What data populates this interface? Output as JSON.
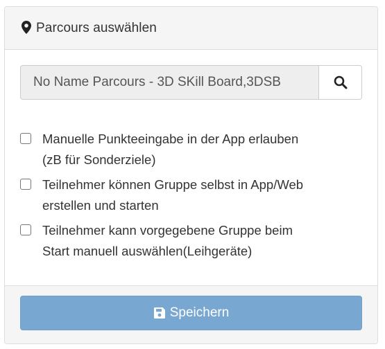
{
  "panel": {
    "title": "Parcours auswählen",
    "title_icon": "map-marker-icon"
  },
  "search": {
    "value": "No Name Parcours - 3D SKill Board,3DSB",
    "button_icon": "search-icon"
  },
  "options": [
    {
      "label_line1": "Manuelle Punkteeingabe in der App erlauben",
      "label_line2": "(zB für Sonderziele)",
      "checked": false
    },
    {
      "label_line1": "Teilnehmer können Gruppe selbst in App/Web",
      "label_line2": "erstellen und starten",
      "checked": false
    },
    {
      "label_line1": "Teilnehmer kann vorgegebene Gruppe beim",
      "label_line2": "Start manuell auswählen(Leihgeräte)",
      "checked": false
    }
  ],
  "footer": {
    "save_label": "Speichern",
    "save_icon": "floppy-disk-icon"
  },
  "colors": {
    "heading_bg": "#f5f5f5",
    "input_bg": "#eeeeee",
    "primary_disabled": "#78a7d2",
    "text": "#333333"
  }
}
